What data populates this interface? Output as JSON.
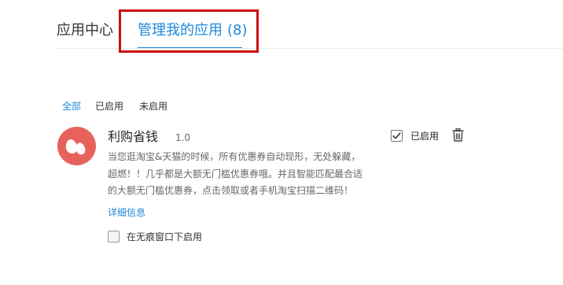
{
  "tabs": {
    "app_center": "应用中心",
    "manage": "管理我的应用",
    "manage_count": "(8)"
  },
  "filters": {
    "all": "全部",
    "enabled": "已启用",
    "disabled": "未启用"
  },
  "extension": {
    "name": "利购省钱",
    "version": "1.0",
    "description_lines": [
      "当您逛淘宝&天猫的时候，所有优惠券自动现形，无处躲藏，",
      "超燃！！几乎都是大额无门槛优惠券哦。并且智能匹配最合适",
      "的大额无门槛优惠券，点击领取或者手机淘宝扫描二维码！"
    ],
    "details_link": "详细信息",
    "incognito_label": "在无痕窗口下启用",
    "incognito_checked": false,
    "enabled_label": "已启用",
    "enabled_checked": true,
    "icon": "teardrop-logo-icon",
    "icon_color": "#e8625c"
  },
  "colors": {
    "accent": "#1e88d8",
    "highlight_box": "#cc1010"
  }
}
